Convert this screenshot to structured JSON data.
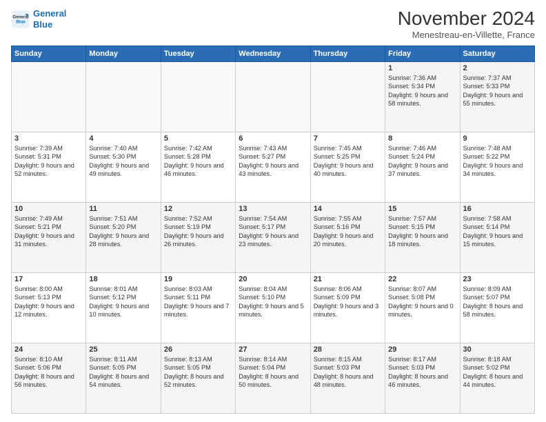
{
  "logo": {
    "line1": "General",
    "line2": "Blue"
  },
  "title": "November 2024",
  "subtitle": "Menestreau-en-Villette, France",
  "headers": [
    "Sunday",
    "Monday",
    "Tuesday",
    "Wednesday",
    "Thursday",
    "Friday",
    "Saturday"
  ],
  "weeks": [
    [
      {
        "day": "",
        "info": ""
      },
      {
        "day": "",
        "info": ""
      },
      {
        "day": "",
        "info": ""
      },
      {
        "day": "",
        "info": ""
      },
      {
        "day": "",
        "info": ""
      },
      {
        "day": "1",
        "info": "Sunrise: 7:36 AM\nSunset: 5:34 PM\nDaylight: 9 hours and 58 minutes."
      },
      {
        "day": "2",
        "info": "Sunrise: 7:37 AM\nSunset: 5:33 PM\nDaylight: 9 hours and 55 minutes."
      }
    ],
    [
      {
        "day": "3",
        "info": "Sunrise: 7:39 AM\nSunset: 5:31 PM\nDaylight: 9 hours and 52 minutes."
      },
      {
        "day": "4",
        "info": "Sunrise: 7:40 AM\nSunset: 5:30 PM\nDaylight: 9 hours and 49 minutes."
      },
      {
        "day": "5",
        "info": "Sunrise: 7:42 AM\nSunset: 5:28 PM\nDaylight: 9 hours and 46 minutes."
      },
      {
        "day": "6",
        "info": "Sunrise: 7:43 AM\nSunset: 5:27 PM\nDaylight: 9 hours and 43 minutes."
      },
      {
        "day": "7",
        "info": "Sunrise: 7:45 AM\nSunset: 5:25 PM\nDaylight: 9 hours and 40 minutes."
      },
      {
        "day": "8",
        "info": "Sunrise: 7:46 AM\nSunset: 5:24 PM\nDaylight: 9 hours and 37 minutes."
      },
      {
        "day": "9",
        "info": "Sunrise: 7:48 AM\nSunset: 5:22 PM\nDaylight: 9 hours and 34 minutes."
      }
    ],
    [
      {
        "day": "10",
        "info": "Sunrise: 7:49 AM\nSunset: 5:21 PM\nDaylight: 9 hours and 31 minutes."
      },
      {
        "day": "11",
        "info": "Sunrise: 7:51 AM\nSunset: 5:20 PM\nDaylight: 9 hours and 28 minutes."
      },
      {
        "day": "12",
        "info": "Sunrise: 7:52 AM\nSunset: 5:19 PM\nDaylight: 9 hours and 26 minutes."
      },
      {
        "day": "13",
        "info": "Sunrise: 7:54 AM\nSunset: 5:17 PM\nDaylight: 9 hours and 23 minutes."
      },
      {
        "day": "14",
        "info": "Sunrise: 7:55 AM\nSunset: 5:16 PM\nDaylight: 9 hours and 20 minutes."
      },
      {
        "day": "15",
        "info": "Sunrise: 7:57 AM\nSunset: 5:15 PM\nDaylight: 9 hours and 18 minutes."
      },
      {
        "day": "16",
        "info": "Sunrise: 7:58 AM\nSunset: 5:14 PM\nDaylight: 9 hours and 15 minutes."
      }
    ],
    [
      {
        "day": "17",
        "info": "Sunrise: 8:00 AM\nSunset: 5:13 PM\nDaylight: 9 hours and 12 minutes."
      },
      {
        "day": "18",
        "info": "Sunrise: 8:01 AM\nSunset: 5:12 PM\nDaylight: 9 hours and 10 minutes."
      },
      {
        "day": "19",
        "info": "Sunrise: 8:03 AM\nSunset: 5:11 PM\nDaylight: 9 hours and 7 minutes."
      },
      {
        "day": "20",
        "info": "Sunrise: 8:04 AM\nSunset: 5:10 PM\nDaylight: 9 hours and 5 minutes."
      },
      {
        "day": "21",
        "info": "Sunrise: 8:06 AM\nSunset: 5:09 PM\nDaylight: 9 hours and 3 minutes."
      },
      {
        "day": "22",
        "info": "Sunrise: 8:07 AM\nSunset: 5:08 PM\nDaylight: 9 hours and 0 minutes."
      },
      {
        "day": "23",
        "info": "Sunrise: 8:09 AM\nSunset: 5:07 PM\nDaylight: 8 hours and 58 minutes."
      }
    ],
    [
      {
        "day": "24",
        "info": "Sunrise: 8:10 AM\nSunset: 5:06 PM\nDaylight: 8 hours and 56 minutes."
      },
      {
        "day": "25",
        "info": "Sunrise: 8:11 AM\nSunset: 5:05 PM\nDaylight: 8 hours and 54 minutes."
      },
      {
        "day": "26",
        "info": "Sunrise: 8:13 AM\nSunset: 5:05 PM\nDaylight: 8 hours and 52 minutes."
      },
      {
        "day": "27",
        "info": "Sunrise: 8:14 AM\nSunset: 5:04 PM\nDaylight: 8 hours and 50 minutes."
      },
      {
        "day": "28",
        "info": "Sunrise: 8:15 AM\nSunset: 5:03 PM\nDaylight: 8 hours and 48 minutes."
      },
      {
        "day": "29",
        "info": "Sunrise: 8:17 AM\nSunset: 5:03 PM\nDaylight: 8 hours and 46 minutes."
      },
      {
        "day": "30",
        "info": "Sunrise: 8:18 AM\nSunset: 5:02 PM\nDaylight: 8 hours and 44 minutes."
      }
    ]
  ]
}
